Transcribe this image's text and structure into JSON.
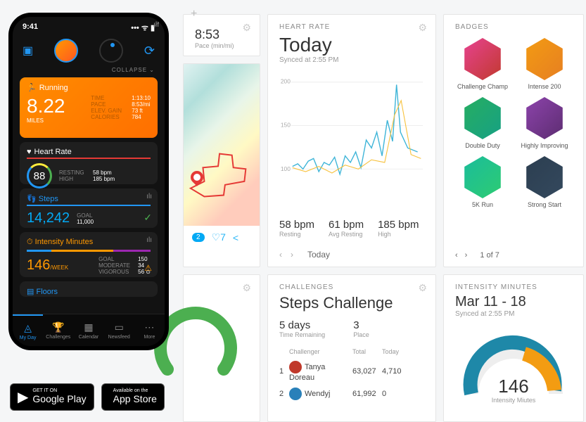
{
  "top": {
    "plus": "+",
    "pace_val": "8:53",
    "pace_lbl": "Pace (min/mi)"
  },
  "map": {
    "comments": "2",
    "likes": "7"
  },
  "heartrate": {
    "label": "HEART RATE",
    "title": "Today",
    "sync": "Synced at 2:55 PM",
    "axis": {
      "a": "200",
      "b": "150",
      "c": "100"
    },
    "stats": [
      {
        "v": "58 bpm",
        "l": "Resting"
      },
      {
        "v": "61 bpm",
        "l": "Avg Resting"
      },
      {
        "v": "185 bpm",
        "l": "High"
      }
    ],
    "nav": "Today"
  },
  "badges": {
    "label": "BADGES",
    "items": [
      {
        "name": "Challenge Champ"
      },
      {
        "name": "Intense 200"
      },
      {
        "name": "Double Duty"
      },
      {
        "name": "Highly Improving"
      },
      {
        "name": "5K Run"
      },
      {
        "name": "Strong Start"
      }
    ],
    "nav": "1 of 7"
  },
  "challenges": {
    "label": "CHALLENGES",
    "title": "Steps Challenge",
    "meta": [
      {
        "v": "5 days",
        "l": "Time Remaining"
      },
      {
        "v": "3",
        "l": "Place"
      }
    ],
    "cols": {
      "c1": "Challenger",
      "c2": "Total",
      "c3": "Today"
    },
    "rows": [
      {
        "n": "1",
        "name": "Tanya Doreau",
        "total": "63,027",
        "today": "4,710"
      },
      {
        "n": "2",
        "name": "Wendyj",
        "total": "61,992",
        "today": "0"
      }
    ]
  },
  "intensity": {
    "label": "INTENSITY MINUTES",
    "title": "Mar 11 - 18",
    "sync": "Synced at 2:55 PM",
    "value": "146",
    "vlabel": "Intensity Miutes"
  },
  "phone": {
    "time": "9:41",
    "collapse": "COLLAPSE ⌄",
    "run": {
      "head": "Running",
      "val": "8.22",
      "unit": "MILES",
      "stats": [
        {
          "k": "TIME",
          "v": "1:13:10"
        },
        {
          "k": "PACE",
          "v": "8:53/mi"
        },
        {
          "k": "ELEV. GAIN",
          "v": "73 ft"
        },
        {
          "k": "CALORIES",
          "v": "784"
        }
      ]
    },
    "hr": {
      "head": "Heart Rate",
      "val": "88",
      "stats": [
        {
          "k": "RESTING",
          "v": "58 bpm"
        },
        {
          "k": "HIGH",
          "v": "185 bpm"
        }
      ]
    },
    "steps": {
      "head": "Steps",
      "val": "14,242",
      "goal_k": "GOAL",
      "goal_v": "11,000"
    },
    "intmin": {
      "head": "Intensity Minutes",
      "val": "146",
      "unit": "/WEEK",
      "stats": [
        {
          "k": "GOAL",
          "v": "150"
        },
        {
          "k": "MODERATE",
          "v": "34"
        },
        {
          "k": "VIGOROUS",
          "v": "56 ⊙"
        }
      ]
    },
    "floors": {
      "head": "Floors"
    },
    "tabs": [
      {
        "l": "My Day"
      },
      {
        "l": "Challenges"
      },
      {
        "l": "Calendar"
      },
      {
        "l": "Newsfeed"
      },
      {
        "l": "More"
      }
    ]
  },
  "store": {
    "gp1": "GET IT ON",
    "gp2": "Google Play",
    "as1": "Available on the",
    "as2": "App Store"
  },
  "chart_data": {
    "type": "line",
    "title": "Heart Rate Today",
    "ylabel": "bpm",
    "ylim": [
      50,
      200
    ],
    "x": "time-of-day",
    "series": [
      {
        "name": "HR",
        "values": [
          105,
          108,
          102,
          110,
          115,
          100,
          112,
          107,
          118,
          98,
          120,
          110,
          125,
          105,
          140,
          130,
          150,
          120,
          165,
          140,
          192,
          150,
          130,
          125
        ]
      }
    ],
    "annotations": {
      "resting": 58,
      "avg_resting": 61,
      "high": 185
    }
  }
}
